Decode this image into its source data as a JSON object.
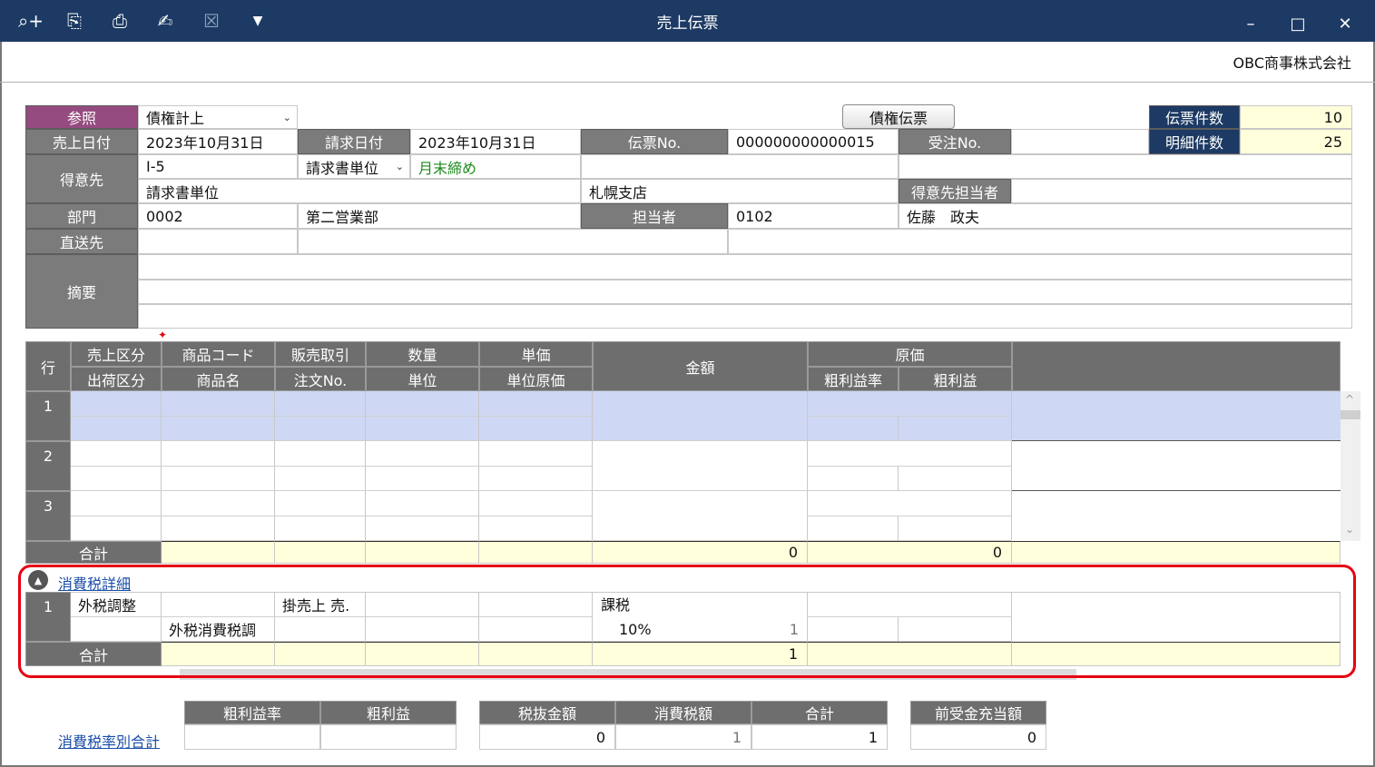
{
  "window": {
    "title": "売上伝票",
    "company": "OBC商事株式会社",
    "minimize": "–",
    "maximize": "□",
    "close": "✕"
  },
  "toolbar": {
    "icons": [
      "zoom-in-icon",
      "preview-icon",
      "print-icon",
      "pdf-sign-icon",
      "excel-icon",
      "dropdown-icon"
    ],
    "zoom": "⌕+",
    "preview": "⎘",
    "print": "⎙",
    "pdf": "✍",
    "excel": "☒",
    "more": "▼"
  },
  "header": {
    "ref_label": "参照",
    "ref_value": "債権計上",
    "credit_button": "債権伝票",
    "slip_count_label": "伝票件数",
    "slip_count": "10",
    "detail_count_label": "明細件数",
    "detail_count": "25",
    "sales_date_label": "売上日付",
    "sales_date": "2023年10月31日",
    "billing_date_label": "請求日付",
    "billing_date": "2023年10月31日",
    "slip_no_label": "伝票No.",
    "slip_no": "000000000000015",
    "order_no_label": "受注No.",
    "order_no": "",
    "customer_label": "得意先",
    "customer_code": "I-5",
    "invoice_unit_label": "請求書単位",
    "closing": "月末締め",
    "customer_name": "請求書単位",
    "branch": "札幌支店",
    "customer_person_label": "得意先担当者",
    "dept_label": "部門",
    "dept_code": "0002",
    "dept_name": "第二営業部",
    "staff_label": "担当者",
    "staff_code": "0102",
    "staff_name": "佐藤　政夫",
    "direct_label": "直送先",
    "summary_label": "摘要"
  },
  "grid": {
    "col_row": "行",
    "col_sales_type": "売上区分",
    "col_ship_type": "出荷区分",
    "col_item_code": "商品コード",
    "col_item_name": "商品名",
    "col_trade": "販売取引",
    "col_order_no": "注文No.",
    "col_qty": "数量",
    "col_unit": "単位",
    "col_price": "単価",
    "col_unit_cost": "単位原価",
    "col_amount": "金額",
    "col_cost": "原価",
    "col_margin_rate": "粗利益率",
    "col_margin": "粗利益",
    "rows": [
      "1",
      "2",
      "3"
    ],
    "total_label": "合計",
    "total_amount": "0",
    "total_margin": "0"
  },
  "tax": {
    "link": "消費税詳細",
    "row": "1",
    "sales_type": "外税調整",
    "item_name": "外税消費税調",
    "trade": "掛売上 売.",
    "tax_type": "課税",
    "tax_rate": "10%",
    "amount_small": "1",
    "total_label": "合計",
    "total_amount": "1"
  },
  "summary": {
    "link": "消費税率別合計",
    "margin_rate_label": "粗利益率",
    "margin_label": "粗利益",
    "net_label": "税抜金額",
    "tax_label": "消費税額",
    "total_label": "合計",
    "advance_label": "前受金充当額",
    "margin_rate": "",
    "margin": "",
    "net": "0",
    "tax": "1",
    "total": "1",
    "advance": "0"
  }
}
